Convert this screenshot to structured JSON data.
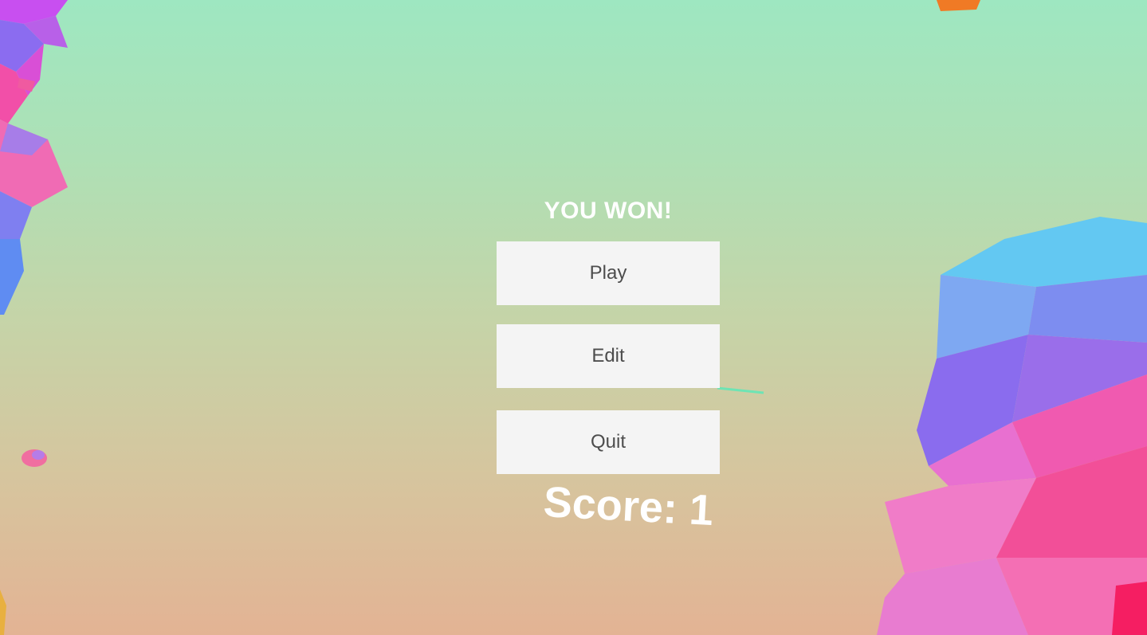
{
  "menu": {
    "title": "YOU WON!",
    "buttons": {
      "play": "Play",
      "edit": "Edit",
      "quit": "Quit"
    }
  },
  "score": {
    "text": "Score: 1"
  },
  "colors": {
    "sky_top": "#9ee7c1",
    "sky_bottom": "#e3b394",
    "button_bg": "#f4f4f4",
    "button_text": "#4d4d4d",
    "title_text": "#ffffff"
  }
}
